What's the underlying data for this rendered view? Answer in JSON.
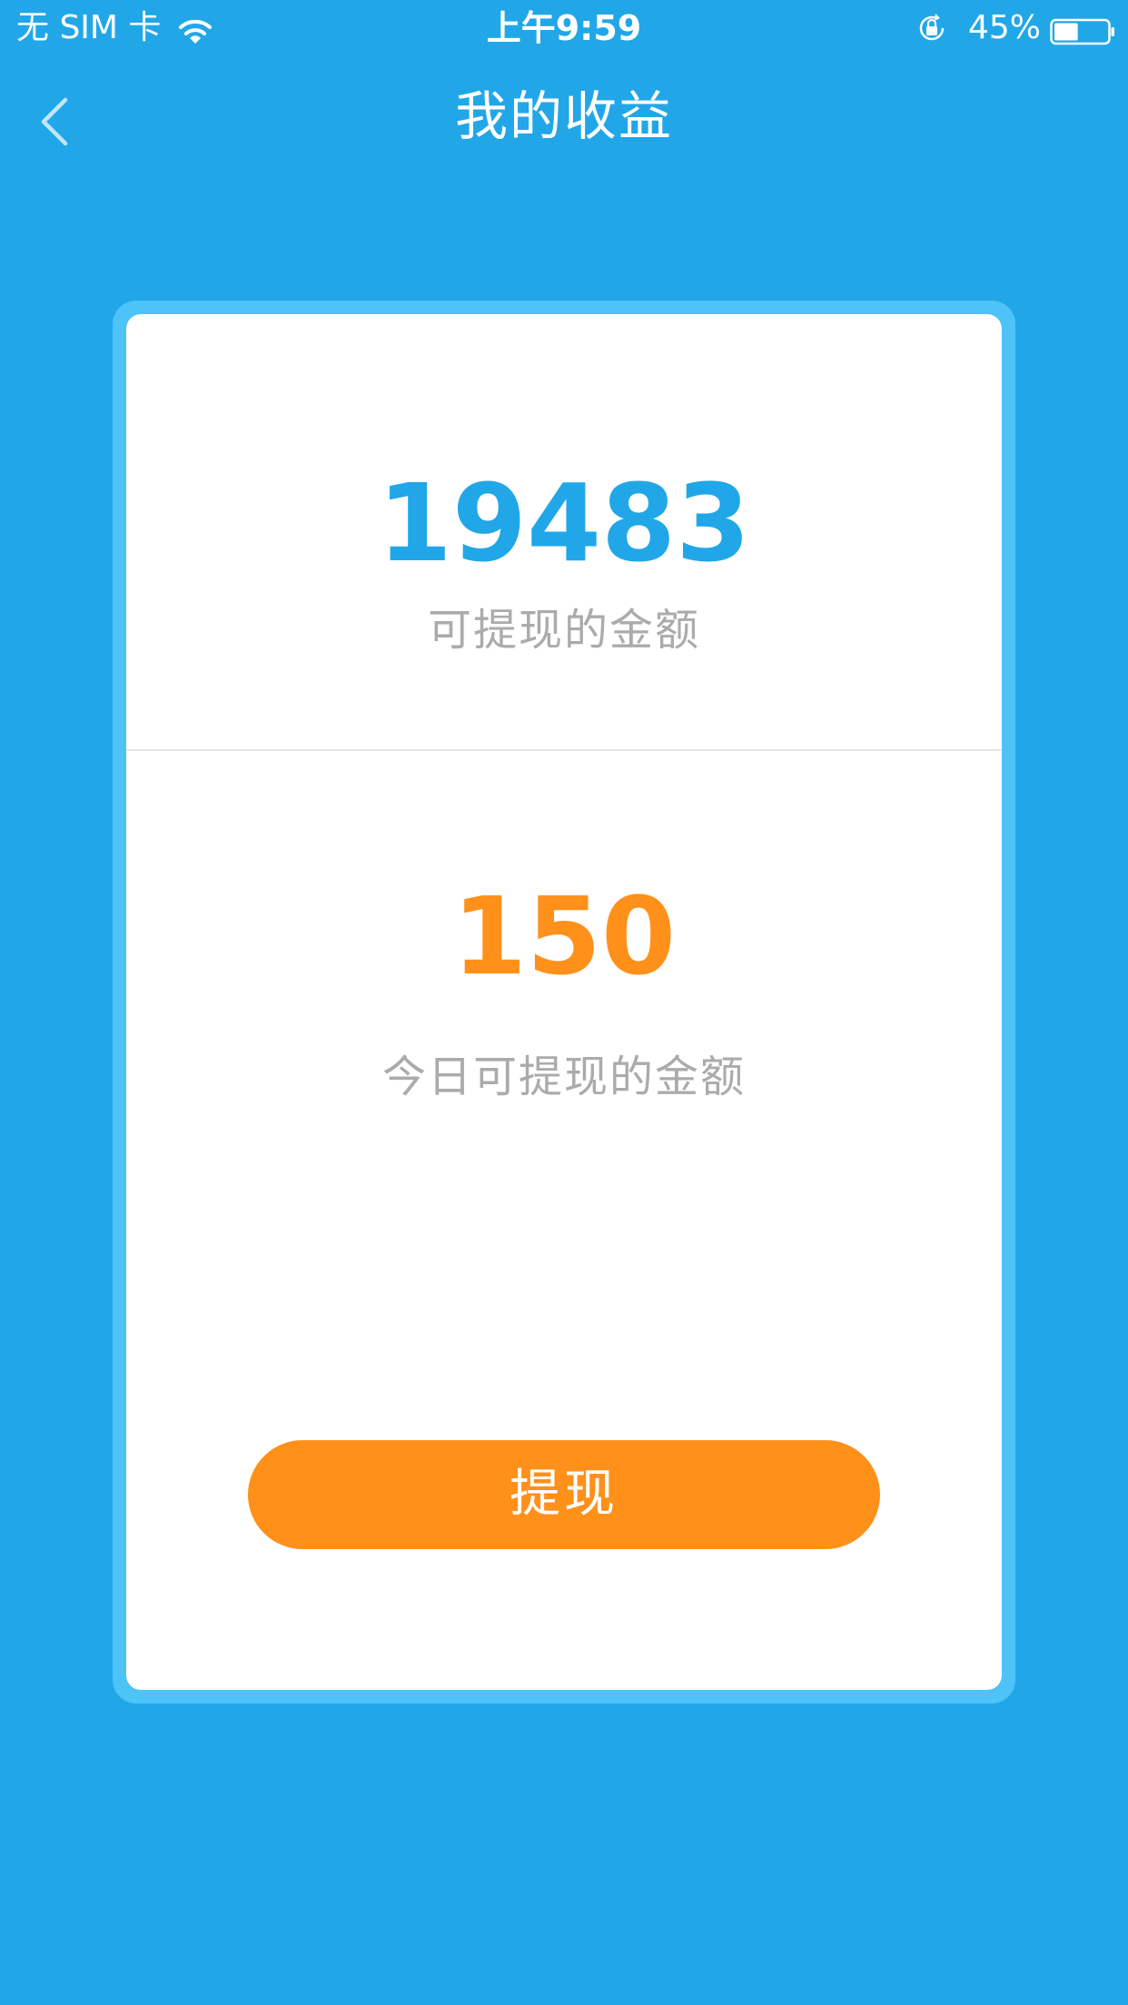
{
  "status_bar": {
    "carrier": "无 SIM 卡",
    "time": "上午9:59",
    "battery_percent": "45%",
    "battery_level": 0.45,
    "icons": [
      "wifi-icon",
      "orientation-lock-icon",
      "battery-icon"
    ]
  },
  "nav": {
    "title": "我的收益",
    "back_icon": "chevron-left-icon"
  },
  "earnings": {
    "total_amount": "19483",
    "total_label": "可提现的金额",
    "today_amount": "150",
    "today_label": "今日可提现的金额"
  },
  "actions": {
    "withdraw_label": "提现"
  },
  "colors": {
    "background": "#21A7E8",
    "card_border": "#4DC3F7",
    "total_amount": "#21A7E8",
    "today_amount": "#FF901A",
    "button": "#FF901A",
    "label_gray": "#ABABAB"
  }
}
